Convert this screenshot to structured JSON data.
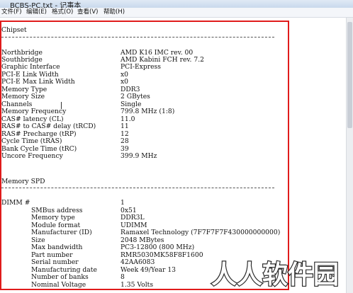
{
  "window": {
    "title": "BCBS-PC.txt - 记事本"
  },
  "menu": [
    {
      "label": "文件(F)"
    },
    {
      "label": "编辑(E)"
    },
    {
      "label": "格式(O)"
    },
    {
      "label": "查看(V)"
    },
    {
      "label": "帮助(H)"
    }
  ],
  "chipset": {
    "heading": "Chipset",
    "rows": [
      {
        "label": "Northbridge",
        "value": "AMD K16 IMC rev. 00"
      },
      {
        "label": "Southbridge",
        "value": "AMD Kabini FCH rev. 7.2"
      },
      {
        "label": "Graphic Interface",
        "value": "PCI-Express"
      },
      {
        "label": "PCI-E Link Width",
        "value": "x0"
      },
      {
        "label": "PCI-E Max Link Width",
        "value": "x0"
      },
      {
        "label": "Memory Type",
        "value": "DDR3"
      },
      {
        "label": "Memory Size",
        "value": "2 GBytes"
      },
      {
        "label": "Channels",
        "value": "Single"
      },
      {
        "label": "Memory Frequency",
        "value": "799.8 MHz (1:8)"
      },
      {
        "label": "CAS# latency (CL)",
        "value": "11.0"
      },
      {
        "label": "RAS# to CAS# delay (tRCD)",
        "value": "11"
      },
      {
        "label": "RAS# Precharge (tRP)",
        "value": "12"
      },
      {
        "label": "Cycle Time (tRAS)",
        "value": "28"
      },
      {
        "label": "Bank Cycle Time (tRC)",
        "value": "39"
      },
      {
        "label": "Uncore Frequency",
        "value": "399.9 MHz"
      }
    ]
  },
  "spd": {
    "heading": "Memory SPD",
    "dimm": {
      "label": "DIMM #",
      "value": "1"
    },
    "rows": [
      {
        "label": "SMBus address",
        "value": "0x51"
      },
      {
        "label": "Memory type",
        "value": "DDR3L"
      },
      {
        "label": "Module format",
        "value": "UDIMM"
      },
      {
        "label": "Manufacturer (ID)",
        "value": "Ramaxel Technology (7F7F7F7F430000000000)"
      },
      {
        "label": "Size",
        "value": "2048 MBytes"
      },
      {
        "label": "Max bandwidth",
        "value": "PC3-12800 (800 MHz)"
      },
      {
        "label": "Part number",
        "value": "RMR5030MK58F8F1600"
      },
      {
        "label": "Serial number",
        "value": "42AA6083"
      },
      {
        "label": "Manufacturing date",
        "value": "Week 49/Year 13"
      },
      {
        "label": "Number of banks",
        "value": "8"
      },
      {
        "label": "Nominal Voltage",
        "value": "1.35 Volts"
      }
    ]
  },
  "watermark": {
    "text": "人人软件园"
  }
}
